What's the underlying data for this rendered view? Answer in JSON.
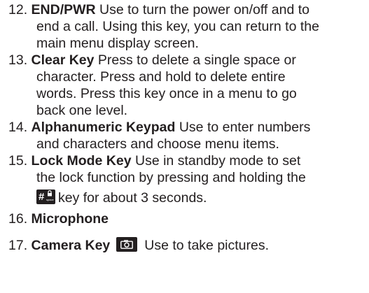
{
  "items": [
    {
      "number": "12.",
      "term": "END/PWR",
      "lines": [
        "Use to turn the power on/off and to",
        "end a call. Using this key, you can return to the",
        "main menu display screen."
      ]
    },
    {
      "number": "13.",
      "term": "Clear Key",
      "lines": [
        "Press to delete a single space or",
        "character. Press and hold to delete entire",
        "words. Press this key once in a menu to go",
        "back one level."
      ]
    },
    {
      "number": "14.",
      "term": "Alphanumeric Keypad",
      "lines": [
        "Use to enter numbers",
        "and characters and choose menu items."
      ]
    },
    {
      "number": "15.",
      "term": "Lock Mode Key",
      "lines": [
        "Use in standby mode to set",
        "the lock function by pressing and holding the",
        "key for about 3 seconds."
      ],
      "key_icon": {
        "symbol": "#",
        "sub_label": "space",
        "icon": "lock-icon"
      }
    },
    {
      "number": "16.",
      "term": "Microphone"
    },
    {
      "number": "17.",
      "term": "Camera Key",
      "text": "Use to take pictures.",
      "key_icon": "camera-icon"
    }
  ]
}
